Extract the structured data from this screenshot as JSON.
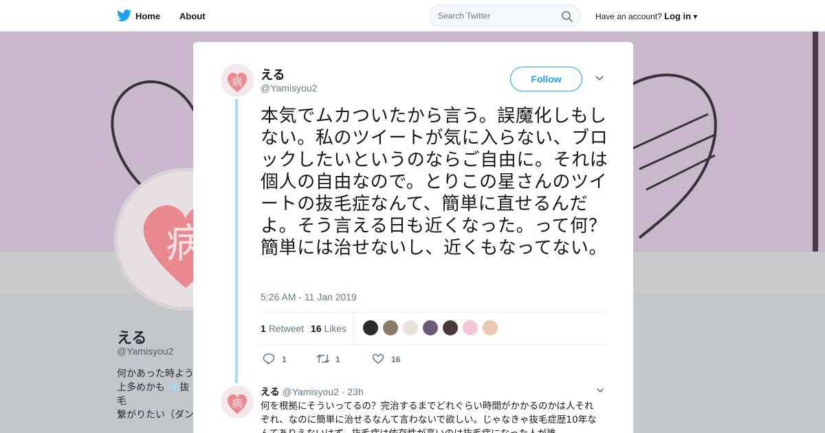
{
  "nav": {
    "home": "Home",
    "about": "About",
    "search_placeholder": "Search Twitter",
    "have_account": "Have an account?",
    "login": "Log in"
  },
  "profile": {
    "name": "える",
    "handle": "@Yamisyou2",
    "bio": "何かあった時よう\n上多めかも ❄️抜毛\n繋がりたい（ダン\n実況、おしゃべり"
  },
  "tweet": {
    "author_name": "える",
    "author_handle": "@Yamisyou2",
    "follow_label": "Follow",
    "text": "本気でムカついたから言う。誤魔化しもしない。私のツイートが気に入らない、ブロックしたいというのならご自由に。それは個人の自由なので。とりこの星さんのツイートの抜毛症なんて、簡単に直せるんだよ。そう言える日も近くなった。って何？簡単には治せないし、近くもなってない。",
    "timestamp": "5:26 AM - 11 Jan 2019",
    "retweets_count": "1",
    "retweets_label": "Retweet",
    "likes_count": "16",
    "likes_label": "Likes",
    "reply_count": "1",
    "retweet_action_count": "1",
    "like_action_count": "16"
  },
  "likers": [
    "#2b2b2b",
    "#8a7a6a",
    "#e9e2d8",
    "#6a5a78",
    "#4a3a3a",
    "#f2c6d8",
    "#e8c8b0"
  ],
  "reply": {
    "author_name": "える",
    "author_handle": "@Yamisyou2",
    "time": "23h",
    "text": "何を根拠にそういってるの？完治するまでどれぐらい時間がかかるのかは人それぞれ、なのに簡単に治せるなんて言わないで欲しい。じゃなきゃ抜毛症歴10年なんてありえないはず。抜毛症は依存性が高いのは抜毛症になった人が誰"
  },
  "colors": {
    "accent": "#1da1f2",
    "thread_line": "#a9d8ef",
    "banner": "#c9b8cc"
  }
}
